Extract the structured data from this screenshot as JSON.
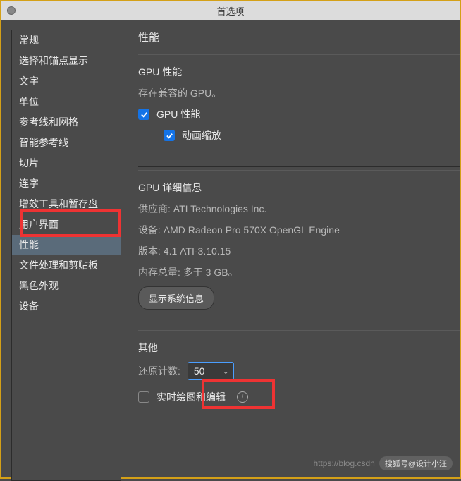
{
  "window": {
    "title": "首选项"
  },
  "sidebar": {
    "items": [
      {
        "label": "常规"
      },
      {
        "label": "选择和锚点显示"
      },
      {
        "label": "文字"
      },
      {
        "label": "单位"
      },
      {
        "label": "参考线和网格"
      },
      {
        "label": "智能参考线"
      },
      {
        "label": "切片"
      },
      {
        "label": "连字"
      },
      {
        "label": "增效工具和暂存盘"
      },
      {
        "label": "用户界面"
      },
      {
        "label": "性能"
      },
      {
        "label": "文件处理和剪贴板"
      },
      {
        "label": "黑色外观"
      },
      {
        "label": "设备"
      }
    ],
    "selected_index": 10
  },
  "main": {
    "title": "性能",
    "gpu_perf": {
      "section_title": "GPU 性能",
      "compat_text": "存在兼容的 GPU。",
      "gpu_checkbox_label": "GPU 性能",
      "gpu_checked": true,
      "anim_zoom_label": "动画缩放",
      "anim_zoom_checked": true
    },
    "gpu_info": {
      "section_title": "GPU 详细信息",
      "vendor_label": "供应商:",
      "vendor_value": "ATI Technologies Inc.",
      "device_label": "设备:",
      "device_value": "AMD Radeon Pro 570X OpenGL Engine",
      "version_label": "版本:",
      "version_value": "4.1 ATI-3.10.15",
      "memory_label": "内存总量:",
      "memory_value": "多于 3 GB。",
      "show_sys_info_btn": "显示系统信息"
    },
    "other": {
      "section_title": "其他",
      "undo_count_label": "还原计数:",
      "undo_count_value": "50",
      "realtime_draw_label": "实时绘图和编辑",
      "realtime_draw_checked": false
    }
  },
  "watermark": {
    "url_fragment": "https://blog.csdn",
    "pill": "搜狐号@设计小汪"
  }
}
